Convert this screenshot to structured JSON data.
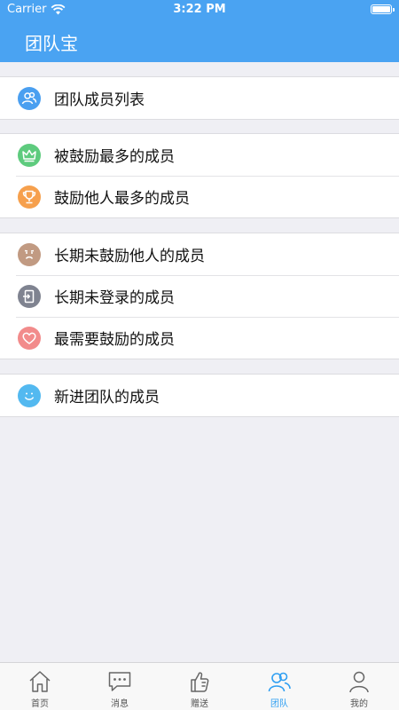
{
  "status_bar": {
    "carrier": "Carrier",
    "time": "3:22 PM"
  },
  "header": {
    "title": "团队宝"
  },
  "groups": [
    {
      "items": [
        {
          "label": "团队成员列表",
          "icon": "team-members-icon",
          "color": "#4a9ff0"
        }
      ]
    },
    {
      "items": [
        {
          "label": "被鼓励最多的成员",
          "icon": "crown-icon",
          "color": "#5ecb7e"
        },
        {
          "label": "鼓励他人最多的成员",
          "icon": "trophy-icon",
          "color": "#f6a04d"
        }
      ]
    },
    {
      "items": [
        {
          "label": "长期未鼓励他人的成员",
          "icon": "sad-face-icon",
          "color": "#c19a82"
        },
        {
          "label": "长期未登录的成员",
          "icon": "exit-door-icon",
          "color": "#7f8390"
        },
        {
          "label": "最需要鼓励的成员",
          "icon": "heart-icon",
          "color": "#f28b8b"
        }
      ]
    },
    {
      "items": [
        {
          "label": "新进团队的成员",
          "icon": "smile-face-icon",
          "color": "#53b9f0"
        }
      ]
    }
  ],
  "tabbar": {
    "active_color": "#2f9ff2",
    "tabs": [
      {
        "label": "首页",
        "icon": "home-icon"
      },
      {
        "label": "消息",
        "icon": "message-icon"
      },
      {
        "label": "赠送",
        "icon": "thumbs-up-icon"
      },
      {
        "label": "团队",
        "icon": "team-icon",
        "active": true
      },
      {
        "label": "我的",
        "icon": "profile-icon"
      }
    ]
  }
}
